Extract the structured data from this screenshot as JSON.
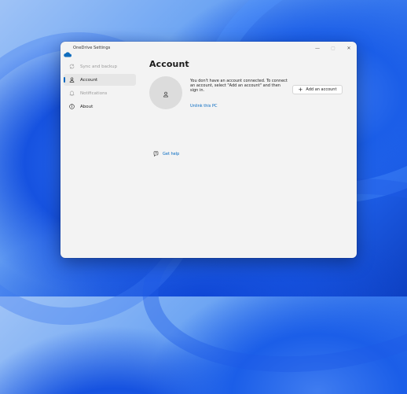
{
  "window": {
    "title": "OneDrive Settings",
    "caption_buttons": {
      "minimize": "—",
      "maximize": "▢",
      "close": "✕"
    }
  },
  "sidebar": {
    "items": [
      {
        "label": "Sync and backup",
        "icon": "sync-icon",
        "state": "disabled"
      },
      {
        "label": "Account",
        "icon": "person-icon",
        "state": "selected"
      },
      {
        "label": "Notifications",
        "icon": "bell-icon",
        "state": "disabled"
      },
      {
        "label": "About",
        "icon": "info-icon",
        "state": "normal"
      }
    ]
  },
  "main": {
    "title": "Account",
    "message": "You don't have an account connected. To connect an account, select \"Add an account\" and then sign in.",
    "unlink_label": "Unlink this PC",
    "add_account_label": "Add an account",
    "help_label": "Get help"
  },
  "colors": {
    "accent": "#0067c0",
    "window_bg": "#f3f3f3",
    "selected_bg": "#e6e6e6",
    "avatar_bg": "#dcdcdc"
  }
}
